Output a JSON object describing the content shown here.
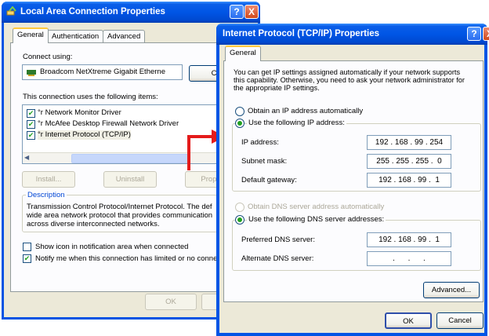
{
  "back_window": {
    "title": "Local Area Connection Properties",
    "title_buttons": [
      "?",
      "X"
    ],
    "tabs": [
      "General",
      "Authentication",
      "Advanced"
    ],
    "connect_using_label": "Connect using:",
    "adapter_name": "Broadcom NetXtreme Gigabit Etherne",
    "configure_label": "Configu",
    "items_label": "This connection uses the following items:",
    "items": [
      {
        "label": "Network Monitor Driver",
        "checked": true
      },
      {
        "label": "McAfee Desktop Firewall Network Driver",
        "checked": true
      },
      {
        "label": "Internet Protocol (TCP/IP)",
        "checked": true
      }
    ],
    "install_label": "Install...",
    "uninstall_label": "Uninstall",
    "properties_label": "Propert",
    "description_title": "Description",
    "description_lines": [
      "Transmission Control Protocol/Internet Protocol. The def",
      "wide area network protocol that provides communication",
      "across diverse interconnected networks."
    ],
    "show_icon_label": "Show icon in notification area when connected",
    "show_icon_checked": false,
    "notify_label": "Notify me when this connection has limited or no connec",
    "notify_checked": true,
    "ok_label": "OK"
  },
  "front_window": {
    "title": "Internet Protocol (TCP/IP) Properties",
    "title_buttons": [
      "?",
      "X"
    ],
    "tab": "General",
    "intro_lines": [
      "You can get IP settings assigned automatically if your network supports",
      "this capability. Otherwise, you need to ask your network administrator for",
      "the appropriate IP settings."
    ],
    "radio_obtain_ip": "Obtain an IP address automatically",
    "radio_use_ip": "Use the following IP address:",
    "ip_address_label": "IP address:",
    "ip_address": "192 . 168 . 99 . 254",
    "subnet_label": "Subnet mask:",
    "subnet": "255 . 255 . 255 .  0",
    "gateway_label": "Default gateway:",
    "gateway": "192 . 168 . 99 .  1",
    "radio_obtain_dns": "Obtain DNS server address automatically",
    "radio_use_dns": "Use the following DNS server addresses:",
    "preferred_dns_label": "Preferred DNS server:",
    "preferred_dns": "192 . 168 . 99 .  1",
    "alternate_dns_label": "Alternate DNS server:",
    "alternate_dns": "   .      .      .   ",
    "advanced_label": "Advanced...",
    "ok_label": "OK",
    "cancel_label": "Cancel"
  },
  "colors": {
    "titlebar": "#0055e5",
    "arrow": "#e41b1b",
    "face": "#ece9d8"
  }
}
